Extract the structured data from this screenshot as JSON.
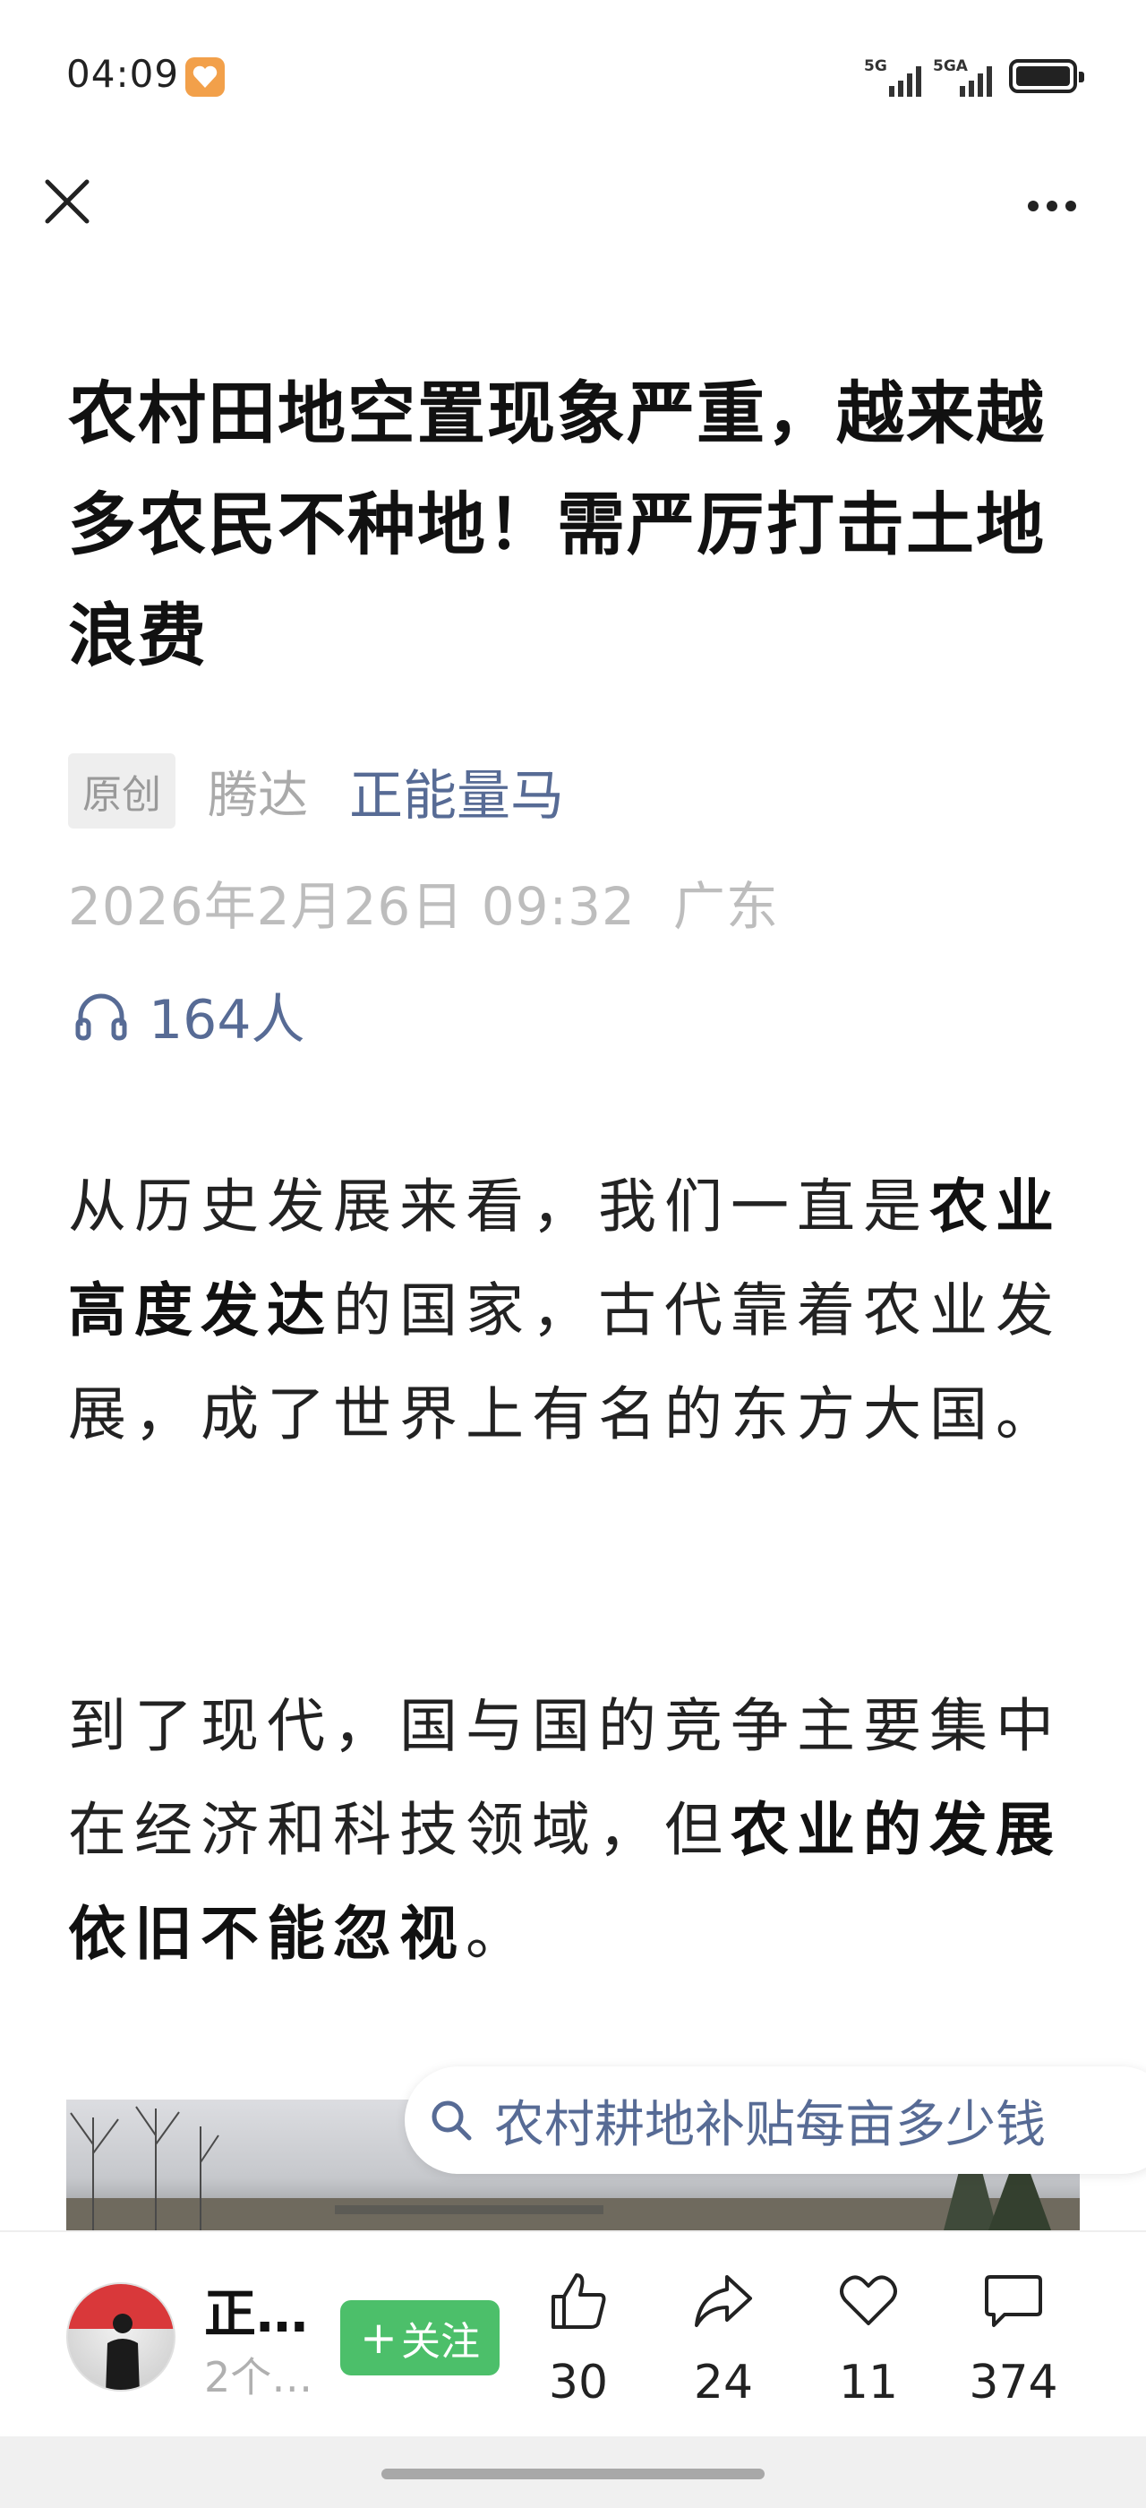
{
  "status_bar": {
    "time": "04:09",
    "signal1_label": "5G",
    "signal2_label": "5GA"
  },
  "article": {
    "title": "农村田地空置现象严重，越来越多农民不种地！需严厉打击土地浪费",
    "original_tag": "原创",
    "author_sub": "腾达",
    "author": "正能量马",
    "date": "2026年2月26日 09:32",
    "region": "广东",
    "listen_count": "164人",
    "para1": {
      "s1": "从历史发展来看，我们一直是",
      "b1": "农业高度发达",
      "s2": "的国家，古代靠着农业发展，成了世界上有名的东方大国。"
    },
    "para2": {
      "s1": "到了现代，国与国的竞争主要集中在经济和科技领域，但",
      "b1": "农业的发展依旧不能忽视",
      "s2": "。"
    }
  },
  "search_suggestion": "农村耕地补贴每亩多少钱",
  "bottom_bar": {
    "account_name": "正…",
    "account_sub": "2个…",
    "follow_label": "关注",
    "like_count": "30",
    "share_count": "24",
    "favorite_count": "11",
    "comment_count": "374"
  },
  "icons": [
    "close-icon",
    "more-icon",
    "headphones-icon",
    "search-icon",
    "thumbs-up-icon",
    "share-icon",
    "heart-icon",
    "comment-icon"
  ],
  "colors": {
    "link_blue": "#576b95",
    "follow_green": "#4cbf6a",
    "meta_gray": "#bdbdbd"
  }
}
